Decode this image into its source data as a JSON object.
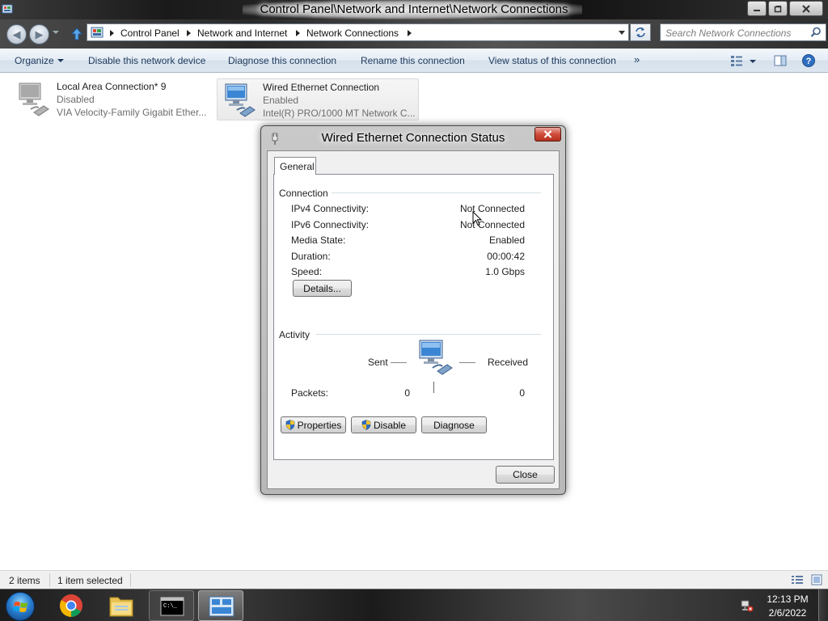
{
  "window": {
    "title": "Control Panel\\Network and Internet\\Network Connections"
  },
  "address_bar": {
    "crumbs": [
      "Control Panel",
      "Network and Internet",
      "Network Connections"
    ],
    "search_placeholder": "Search Network Connections"
  },
  "command_bar": {
    "organize": "Organize",
    "disable": "Disable this network device",
    "diagnose": "Diagnose this connection",
    "rename": "Rename this connection",
    "view_status": "View status of this connection",
    "more": "»"
  },
  "connections": [
    {
      "name": "Local Area Connection* 9",
      "state": "Disabled",
      "device": "VIA Velocity-Family Gigabit Ether..."
    },
    {
      "name": "Wired Ethernet Connection",
      "state": "Enabled",
      "device": "Intel(R) PRO/1000 MT Network C..."
    }
  ],
  "status_bar": {
    "items": "2 items",
    "selected": "1 item selected"
  },
  "taskbar": {
    "time": "12:13 PM",
    "date": "2/6/2022"
  },
  "dialog": {
    "title": "Wired Ethernet Connection Status",
    "tab": "General",
    "connection_group": "Connection",
    "rows": [
      {
        "label": "IPv4 Connectivity:",
        "value": "Not Connected"
      },
      {
        "label": "IPv6 Connectivity:",
        "value": "Not Connected"
      },
      {
        "label": "Media State:",
        "value": "Enabled"
      },
      {
        "label": "Duration:",
        "value": "00:00:42"
      },
      {
        "label": "Speed:",
        "value": "1.0 Gbps"
      }
    ],
    "details_button": "Details...",
    "activity_group": "Activity",
    "sent_label": "Sent",
    "received_label": "Received",
    "packets_label": "Packets:",
    "packets_sent": "0",
    "packets_received": "0",
    "properties_button": "Properties",
    "disable_button": "Disable",
    "diagnose_button": "Diagnose",
    "close_button": "Close"
  }
}
